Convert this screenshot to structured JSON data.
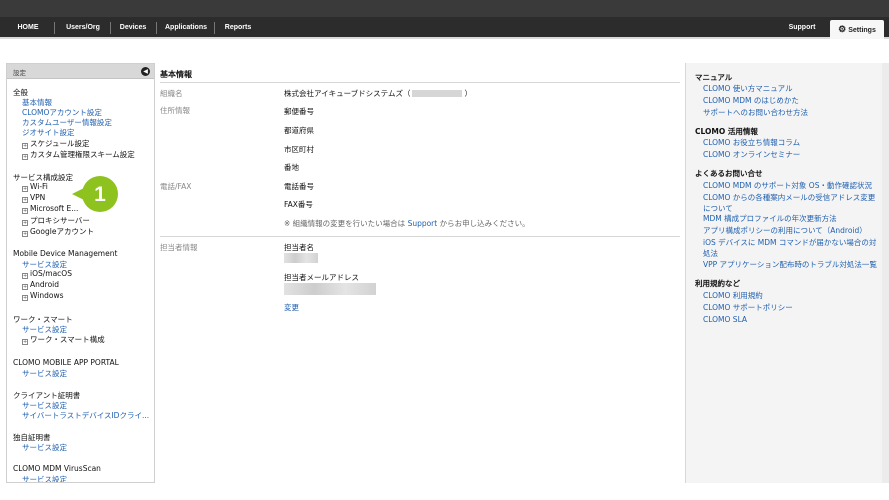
{
  "nav": {
    "items": [
      "HOME",
      "Users/Org",
      "Devices",
      "Applications",
      "Reports"
    ],
    "support": "Support",
    "settings": "Settings"
  },
  "sidebar": {
    "header": "設定",
    "groups": [
      {
        "title": "全般",
        "links": [
          "基本情報",
          "CLOMOアカウント設定",
          "カスタムユーザー情報設定",
          "ジオサイト設定"
        ],
        "expandables": [
          "スケジュール設定",
          "カスタム管理権限スキーム設定"
        ]
      },
      {
        "title": "サービス構成設定",
        "expandables": [
          "Wi-Fi",
          "VPN",
          "Microsoft E...",
          "プロキシサーバー",
          "Googleアカウント"
        ]
      },
      {
        "title": "Mobile Device Management",
        "links": [
          "サービス設定"
        ],
        "expandables": [
          "iOS/macOS",
          "Android",
          "Windows"
        ]
      },
      {
        "title": "ワーク・スマート",
        "links": [
          "サービス設定"
        ],
        "expandables": [
          "ワーク・スマート構成"
        ]
      },
      {
        "title": "CLOMO MOBILE APP PORTAL",
        "links": [
          "サービス設定"
        ]
      },
      {
        "title": "クライアント証明書",
        "links": [
          "サービス設定",
          "サイバートラストデバイスIDクライ..."
        ]
      },
      {
        "title": "独自証明書",
        "links": [
          "サービス設定"
        ]
      },
      {
        "title": "CLOMO MDM VirusScan",
        "links": [
          "サービス設定"
        ]
      }
    ]
  },
  "callout": {
    "number": "1"
  },
  "main": {
    "title": "基本情報",
    "org_label": "組織名",
    "org_value_prefix": "株式会社アイキューブドシステムズ（",
    "org_value_suffix": "）",
    "address_label": "住所情報",
    "address_fields": [
      "郵便番号",
      "都道府県",
      "市区町村",
      "番地"
    ],
    "phone_label": "電話/FAX",
    "phone_fields": [
      "電話番号",
      "FAX番号"
    ],
    "note_prefix": "※ 組織情報の変更を行いたい場合は ",
    "note_link": "Support",
    "note_suffix": " からお申し込みください。",
    "contact_label": "担当者情報",
    "contact_name": "担当者名",
    "contact_email": "担当者メールアドレス",
    "change_link": "変更"
  },
  "right": {
    "sections": [
      {
        "title": "マニュアル",
        "links": [
          "CLOMO 使い方マニュアル",
          "CLOMO MDM のはじめかた",
          "サポートへのお問い合わせ方法"
        ]
      },
      {
        "title": "CLOMO 活用情報",
        "links": [
          "CLOMO お役立ち情報コラム",
          "CLOMO オンラインセミナー"
        ]
      },
      {
        "title": "よくあるお問い合せ",
        "links": [
          "CLOMO MDM のサポート対象 OS・動作確認状況",
          "CLOMO からの各種案内メールの受信アドレス変更について",
          "MDM 構成プロファイルの年次更新方法",
          "アプリ構成ポリシーの利用について（Android）",
          "iOS デバイスに MDM コマンドが届かない場合の対処法",
          "VPP アプリケーション配布時のトラブル対処法一覧"
        ]
      },
      {
        "title": "利用規約など",
        "links": [
          "CLOMO 利用規約",
          "CLOMO サポートポリシー",
          "CLOMO SLA"
        ]
      }
    ]
  }
}
